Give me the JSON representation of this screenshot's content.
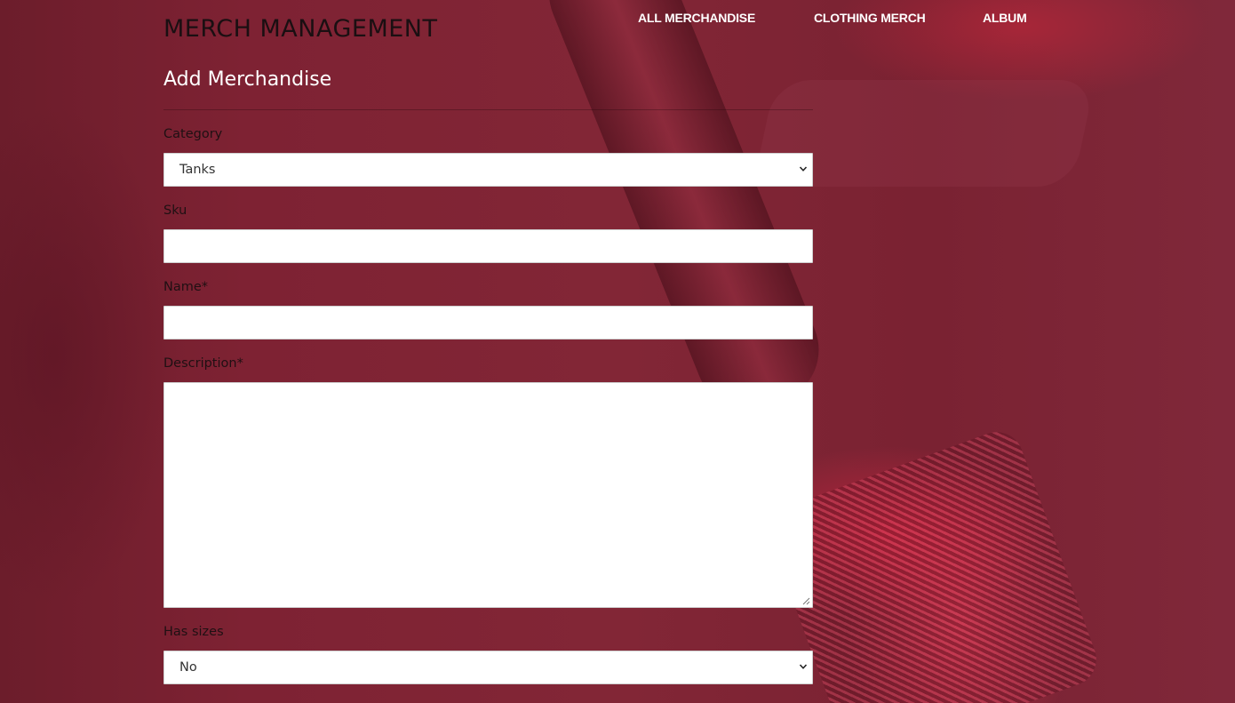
{
  "header": {
    "title": "MERCH MANAGEMENT",
    "nav": [
      {
        "label": "ALL MERCHANDISE"
      },
      {
        "label": "CLOTHING MERCH"
      },
      {
        "label": "ALBUM"
      }
    ]
  },
  "form": {
    "title": "Add Merchandise",
    "fields": {
      "category": {
        "label": "Category",
        "value": "Tanks"
      },
      "sku": {
        "label": "Sku",
        "value": ""
      },
      "name": {
        "label": "Name*",
        "value": ""
      },
      "description": {
        "label": "Description*",
        "value": ""
      },
      "has_sizes": {
        "label": "Has sizes",
        "value": "No"
      }
    }
  },
  "icons": {
    "select_arrow": "chevron-down-icon",
    "resize_handle": "resize-grip-icon"
  },
  "colors": {
    "background": "#7a2130",
    "nav_text": "#ffffff",
    "title_text": "#1a0f12",
    "field_background": "#ffffff"
  }
}
